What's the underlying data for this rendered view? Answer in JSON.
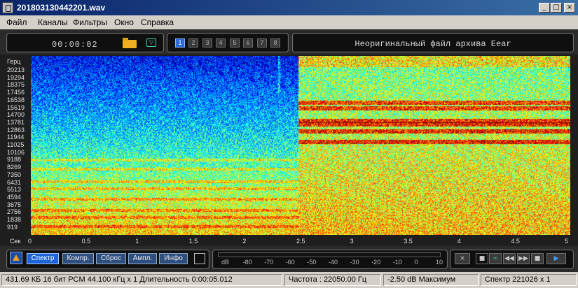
{
  "window": {
    "title": "201803130442201.wav"
  },
  "window_controls": {
    "minimize": "_",
    "maximize": "□",
    "close": "×"
  },
  "menu": [
    "Файл",
    "Каналы",
    "Фильтры",
    "Окно",
    "Справка"
  ],
  "toolbar": {
    "time": "00:00:02",
    "channels": [
      "1",
      "2",
      "3",
      "4",
      "5",
      "6",
      "7",
      "8"
    ],
    "active_channel": "1",
    "message": "Неоригинальный файл архива Eear"
  },
  "spectrogram": {
    "y_unit": "Герц",
    "y_ticks": [
      "20213",
      "19294",
      "18375",
      "17456",
      "16538",
      "15619",
      "14700",
      "13781",
      "12863",
      "11944",
      "11025",
      "10106",
      "9188",
      "8269",
      "7350",
      "6431",
      "5513",
      "4594",
      "3675",
      "2756",
      "1838",
      "919"
    ],
    "x_unit": "Сек",
    "x_ticks": [
      "0",
      "0.5",
      "1",
      "1.5",
      "2",
      "2.5",
      "3",
      "3.5",
      "4",
      "4.5",
      "5"
    ],
    "max_seconds": 5
  },
  "bottom_toolbar": {
    "buttons": [
      "Спектр",
      "Компр.",
      "Сброс",
      "Ампл.",
      "Инфо"
    ],
    "active": "Спектр",
    "db_scale": [
      "dB",
      "-80",
      "-70",
      "-60",
      "-50",
      "-40",
      "-30",
      "-20",
      "-10",
      "0",
      "10"
    ],
    "player": [
      "×",
      "■",
      "∞",
      "◀◀",
      "▶▶",
      "■",
      "▶"
    ]
  },
  "status": {
    "file_info": "431.69 КБ 16 бит PCM 44.100 кГц x 1  Длительность 0:00:05.012",
    "frequency": "Частота : 22050.00 Гц",
    "level": "-2.50 dB Максимум",
    "spectrum": "Спектр 221026 x 1"
  },
  "colors": {
    "accent": "#2c6bd8",
    "dark_bg": "#2a2a2a"
  }
}
